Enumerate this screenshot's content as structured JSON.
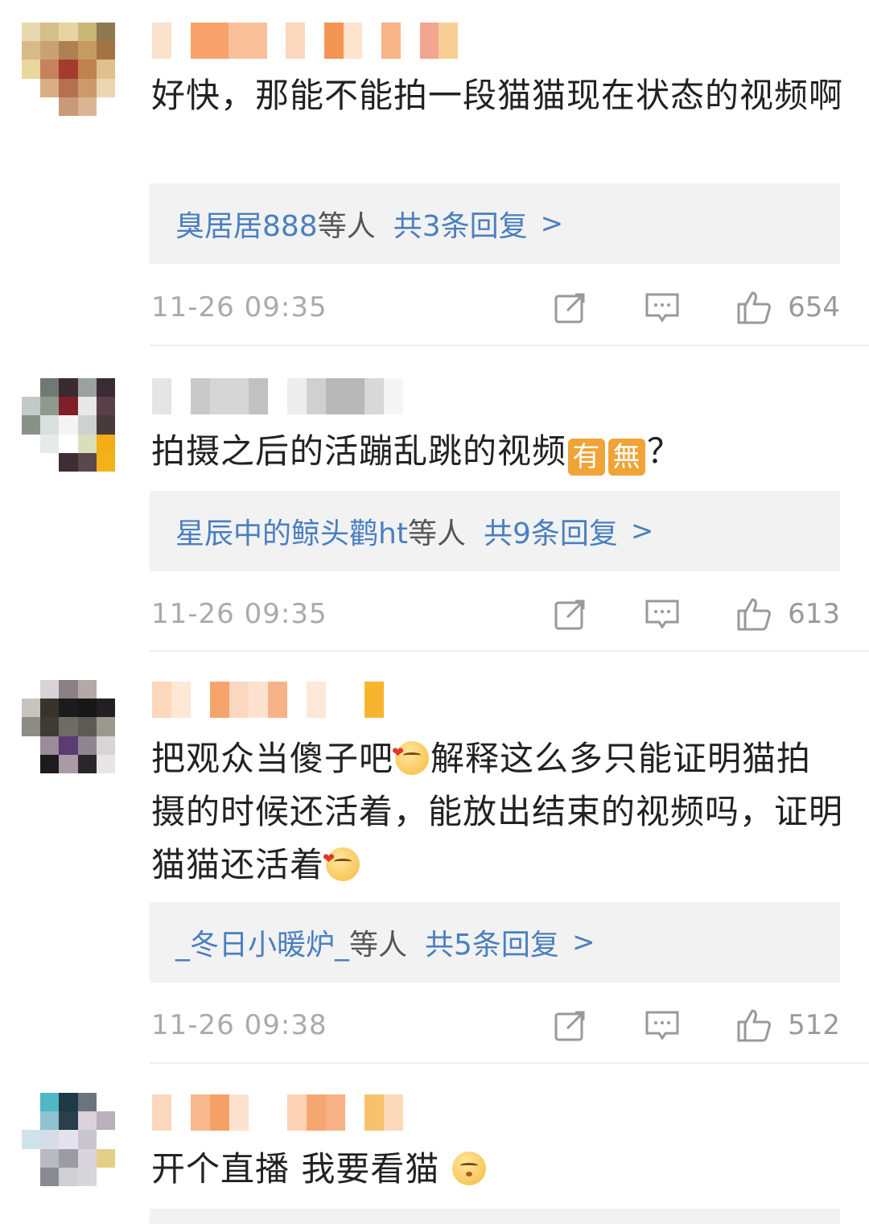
{
  "comments": [
    {
      "text": "好快，那能不能拍一段猫猫现在状态的视频啊",
      "reply_names": "臭居居888",
      "reply_etc": "等人",
      "reply_count": "共3条回复",
      "chevron": ">",
      "time": "11-26 09:35",
      "likes": "654"
    },
    {
      "text_before": "拍摄之后的活蹦乱跳的视频",
      "emoji_1": "有",
      "emoji_2": "無",
      "text_after": "？",
      "reply_names": "星辰中的鲸头鹳ht",
      "reply_etc": "等人",
      "reply_count": "共9条回复",
      "chevron": ">",
      "time": "11-26 09:35",
      "likes": "613"
    },
    {
      "text_part1": "把观众当傻子吧",
      "text_part2": "解释这么多只能证明猫拍摄的时候还活着，能放出结束的视频吗，证明猫猫还活着",
      "reply_names": "_冬日小暖炉_",
      "reply_etc": "等人",
      "reply_count": "共5条回复",
      "chevron": ">",
      "time": "11-26 09:38",
      "likes": "512"
    },
    {
      "text": "开个直播 我要看猫"
    }
  ],
  "icons": {
    "share": "share-icon",
    "comment": "comment-icon",
    "like": "thumbs-up-icon",
    "emoji_heart": "blush-heart-emoji-icon",
    "emoji_kiss": "kiss-emoji-icon"
  },
  "colors": {
    "link": "#4a7fc0",
    "reply_bg": "#f2f2f2",
    "emoji_box": "#f5a623"
  }
}
